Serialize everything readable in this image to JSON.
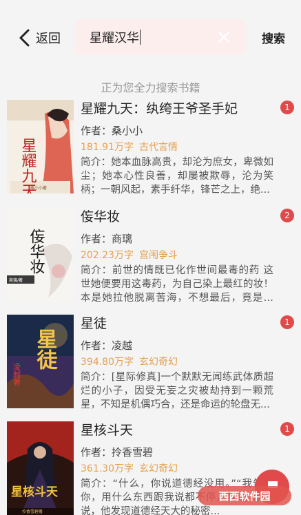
{
  "header": {
    "back_label": "返回",
    "search_value": "星耀汉华",
    "search_action": "搜索"
  },
  "status_text": "正为您全力搜索书籍",
  "books": [
    {
      "title": "星耀九天：纨绔王爷圣手妃",
      "author": "作者：桑小小",
      "words": "181.91万字",
      "genre": "古代言情",
      "intro": "简介：她本血脉高贵，却沦为庶女，卑微如尘；她本心性良善，却屡被欺辱，沦为笑柄；一朝风起，素手纤华，锋芒之上，绝...",
      "badge": "1",
      "cover_text": "星耀九天",
      "cover_author": "桑小小著"
    },
    {
      "title": "侫华妆",
      "author": "作者：商璃",
      "words": "202.23万字",
      "genre": "宫闱争斗",
      "intro": "简介：前世的情既已化作世间最毒的药 这世她便要用这毒药，为自己染上最红的妆！本是她拉他脱离苦海，不想最后，竟是被他...",
      "badge": "2",
      "cover_text": "侫华妆",
      "cover_author": "商璃/著"
    },
    {
      "title": "星徒",
      "author": "作者：凌越",
      "words": "394.80万字",
      "genre": "玄幻奇幻",
      "intro": "简介：[星际修真]一个默默无闻练武体质超烂的小子，因受无妄之灾被劫持到一颗荒星，不知是机偶巧合，还是命运的轮盘无...",
      "badge": "1",
      "cover_text": "星徒",
      "cover_author": "凌越著"
    },
    {
      "title": "星核斗天",
      "author": "作者：拎香雪碧",
      "words": "361.30万字",
      "genre": "玄幻奇幻",
      "intro": "简介：“什么，你说道德经没用。”“我告诉你，用什么东西跟我说都不停，我说”就是说，他发现道德经天大的秘密...",
      "badge": "1",
      "cover_text": "星核斗天",
      "cover_author": "拎香雪碧著"
    }
  ],
  "watermark": "西西软件园",
  "colors": {
    "accent": "#e04a4a",
    "meta": "#e6a04e",
    "search_bg": "#fdeeee",
    "page_bg": "#f4f4f4"
  }
}
